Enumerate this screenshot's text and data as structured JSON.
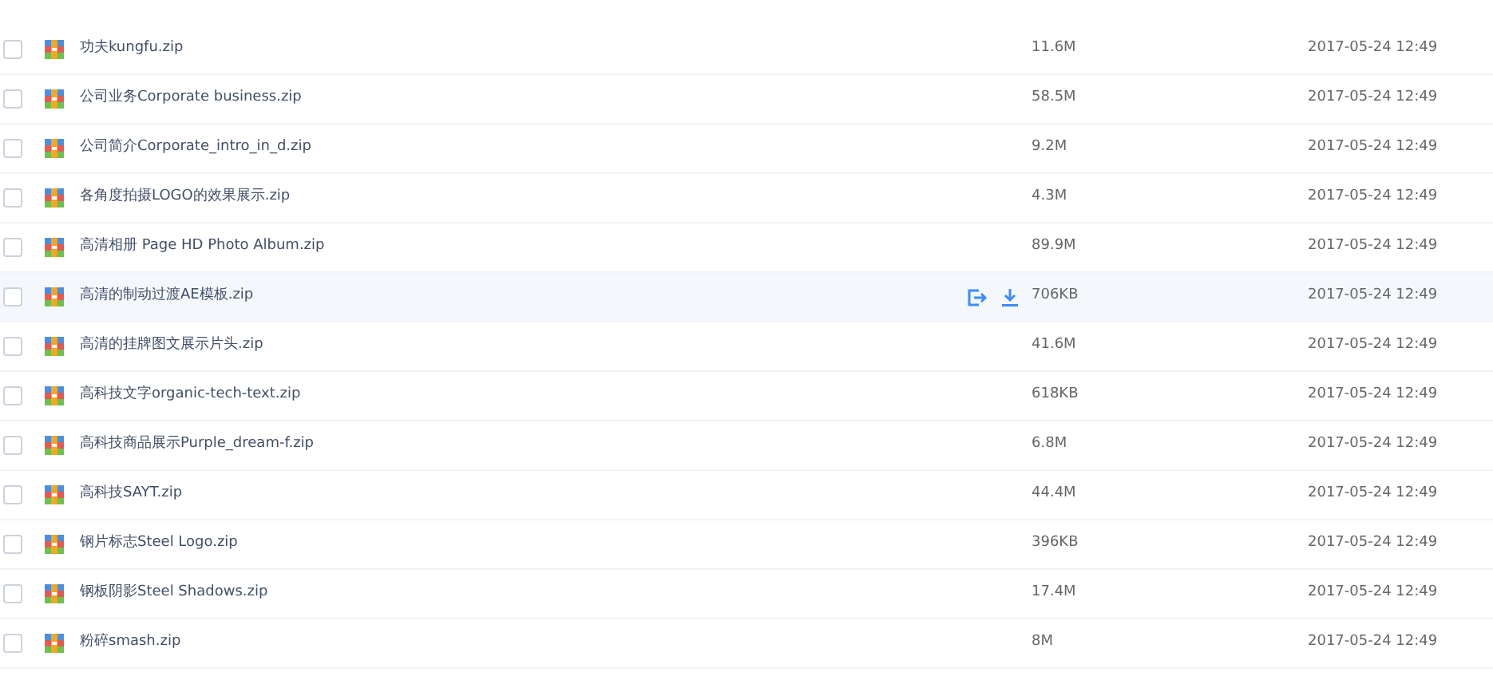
{
  "files": [
    {
      "name": "功夫kungfu.zip",
      "size": "11.6M",
      "modified": "2017-05-24 12:49",
      "checked": false,
      "hovered": false
    },
    {
      "name": "公司业务Corporate business.zip",
      "size": "58.5M",
      "modified": "2017-05-24 12:49",
      "checked": false,
      "hovered": false
    },
    {
      "name": "公司简介Corporate_intro_in_d.zip",
      "size": "9.2M",
      "modified": "2017-05-24 12:49",
      "checked": false,
      "hovered": false
    },
    {
      "name": "各角度拍摄LOGO的效果展示.zip",
      "size": "4.3M",
      "modified": "2017-05-24 12:49",
      "checked": false,
      "hovered": false
    },
    {
      "name": "高清相册 Page HD Photo Album.zip",
      "size": "89.9M",
      "modified": "2017-05-24 12:49",
      "checked": false,
      "hovered": false
    },
    {
      "name": "高清的制动过渡AE模板.zip",
      "size": "706KB",
      "modified": "2017-05-24 12:49",
      "checked": false,
      "hovered": true
    },
    {
      "name": "高清的挂牌图文展示片头.zip",
      "size": "41.6M",
      "modified": "2017-05-24 12:49",
      "checked": false,
      "hovered": false
    },
    {
      "name": "高科技文字organic-tech-text.zip",
      "size": "618KB",
      "modified": "2017-05-24 12:49",
      "checked": false,
      "hovered": false
    },
    {
      "name": "高科技商品展示Purple_dream-f.zip",
      "size": "6.8M",
      "modified": "2017-05-24 12:49",
      "checked": false,
      "hovered": false
    },
    {
      "name": "高科技SAYT.zip",
      "size": "44.4M",
      "modified": "2017-05-24 12:49",
      "checked": false,
      "hovered": false
    },
    {
      "name": "钢片标志Steel Logo.zip",
      "size": "396KB",
      "modified": "2017-05-24 12:49",
      "checked": false,
      "hovered": false
    },
    {
      "name": "钢板阴影Steel Shadows.zip",
      "size": "17.4M",
      "modified": "2017-05-24 12:49",
      "checked": false,
      "hovered": false
    },
    {
      "name": "粉碎smash.zip",
      "size": "8M",
      "modified": "2017-05-24 12:49",
      "checked": false,
      "hovered": false
    }
  ]
}
